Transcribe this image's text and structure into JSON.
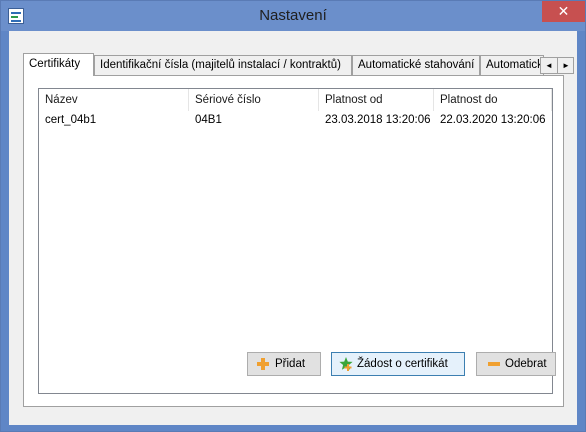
{
  "window": {
    "title": "Nastavení",
    "close_glyph": "✕"
  },
  "tabs": [
    {
      "label": "Certifikáty",
      "active": true
    },
    {
      "label": "Identifikační čísla (majitelů instalací / kontraktů)",
      "active": false
    },
    {
      "label": "Automatické stahování",
      "active": false
    },
    {
      "label": "Automatické",
      "active": false
    }
  ],
  "tab_scroll": {
    "left": "◄",
    "right": "►"
  },
  "table": {
    "columns": [
      "Název",
      "Sériové číslo",
      "Platnost od",
      "Platnost do"
    ],
    "rows": [
      [
        "cert_04b1",
        "04B1",
        "23.03.2018 13:20:06",
        "22.03.2020 13:20:06"
      ]
    ]
  },
  "buttons": {
    "add": {
      "label": "Přidat",
      "icon": "plus-icon"
    },
    "request": {
      "label": "Žádost o certifikát",
      "icon": "star-plus-icon"
    },
    "remove": {
      "label": "Odebrat",
      "icon": "minus-icon"
    }
  },
  "colors": {
    "titlebar": "#6b8fcb",
    "close": "#c75050",
    "plus_orange": "#f0a030",
    "star_green": "#3aa63a"
  }
}
